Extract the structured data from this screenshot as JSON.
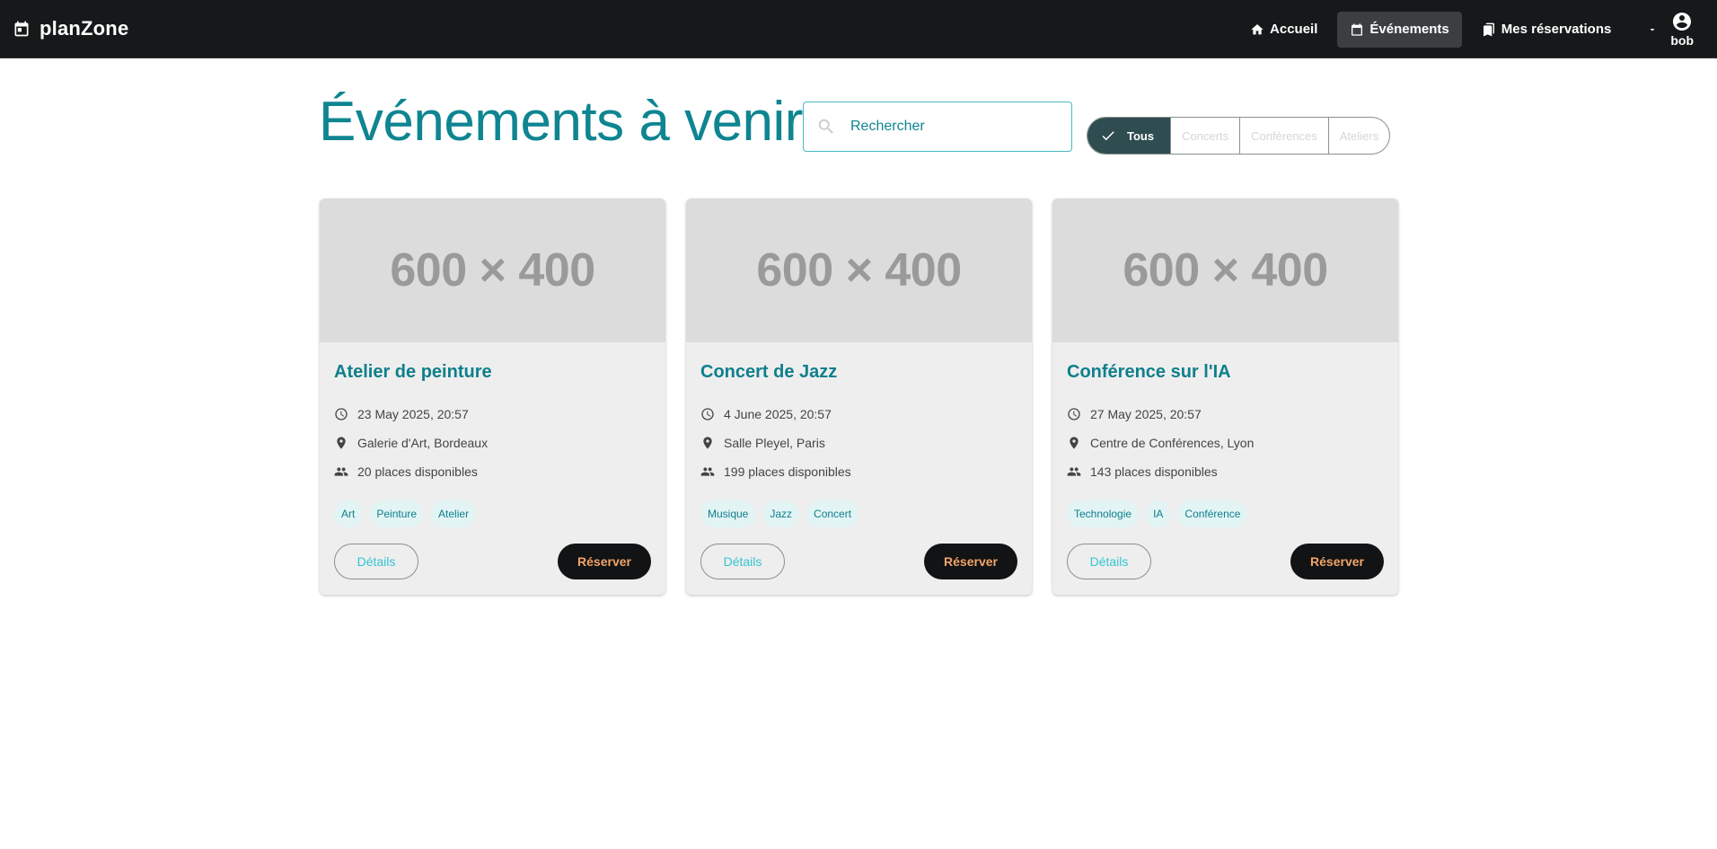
{
  "app": {
    "name": "planZone",
    "icon": "calendar-icon"
  },
  "nav": {
    "home": {
      "label": "Accueil",
      "icon": "home-icon"
    },
    "events": {
      "label": "Événements",
      "icon": "calendar-icon"
    },
    "reservations": {
      "label": "Mes réservations",
      "icon": "bookmarks-icon"
    },
    "user": {
      "name": "bob",
      "icon": "account-circle-icon"
    }
  },
  "page": {
    "title": "Événements à venir"
  },
  "search": {
    "placeholder": "Rechercher"
  },
  "filters": {
    "all": "Tous",
    "concerts": "Concerts",
    "conferences": "Conférences",
    "workshops": "Ateliers",
    "selected": "Tous"
  },
  "cards": [
    {
      "image_text": "600 × 400",
      "title": "Atelier de peinture",
      "date": "23 May 2025, 20:57",
      "location": "Galerie d'Art, Bordeaux",
      "places": "20 places disponibles",
      "tags": [
        "Art",
        "Peinture",
        "Atelier"
      ],
      "details_label": "Détails",
      "reserve_label": "Réserver"
    },
    {
      "image_text": "600 × 400",
      "title": "Concert de Jazz",
      "date": "4 June 2025, 20:57",
      "location": "Salle Pleyel, Paris",
      "places": "199 places disponibles",
      "tags": [
        "Musique",
        "Jazz",
        "Concert"
      ],
      "details_label": "Détails",
      "reserve_label": "Réserver"
    },
    {
      "image_text": "600 × 400",
      "title": "Conférence sur l'IA",
      "date": "27 May 2025, 20:57",
      "location": "Centre de Conférences, Lyon",
      "places": "143 places disponibles",
      "tags": [
        "Technologie",
        "IA",
        "Conférence"
      ],
      "details_label": "Détails",
      "reserve_label": "Réserver"
    }
  ],
  "colors": {
    "topbar": "#16191a",
    "accent": "#0e8591",
    "filter_selected": "#2f4d50",
    "reserve_text": "#f2a46a",
    "tag_bg": "#e3f4f5"
  }
}
